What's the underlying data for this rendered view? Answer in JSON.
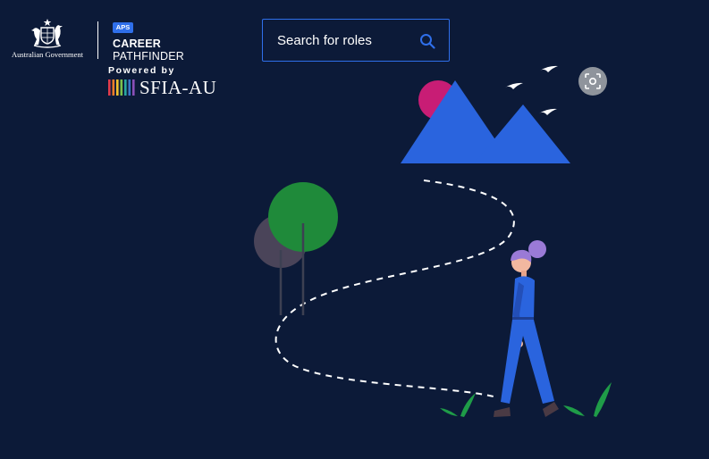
{
  "header": {
    "gov_name": "Australian Government",
    "aps_badge": "APS",
    "career": "CAREER",
    "pathfinder": "PATHFINDER",
    "powered_by": "Powered by",
    "sfia": "SFIA-AU"
  },
  "search": {
    "label": "Search for roles",
    "icon": "search-icon"
  },
  "colors": {
    "background": "#0c1a38",
    "accent": "#2f6fea",
    "sun": "#c81d75",
    "tree_front": "#1f8a3a",
    "tree_back": "#4a4459",
    "hair": "#9a7ad6"
  },
  "icons": {
    "lens": "lens-scan-icon"
  }
}
